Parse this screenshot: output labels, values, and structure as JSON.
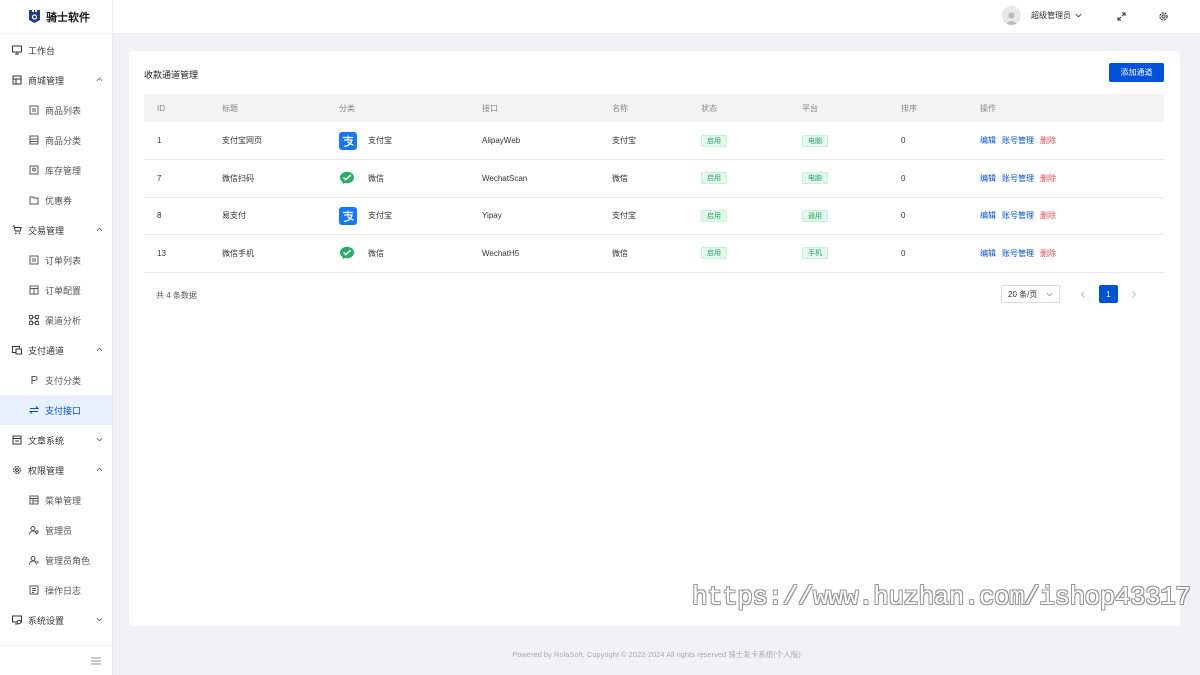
{
  "app": {
    "name": "骑士软件"
  },
  "sidebar": {
    "items": [
      {
        "label": "工作台",
        "icon": "monitor-icon",
        "type": "top"
      },
      {
        "label": "商城管理",
        "icon": "store-icon",
        "type": "group",
        "expanded": true
      },
      {
        "label": "商品列表",
        "icon": "list-icon",
        "type": "child"
      },
      {
        "label": "商品分类",
        "icon": "category-icon",
        "type": "child"
      },
      {
        "label": "库存管理",
        "icon": "inventory-icon",
        "type": "child"
      },
      {
        "label": "优惠券",
        "icon": "folder-icon",
        "type": "child"
      },
      {
        "label": "交易管理",
        "icon": "cart-icon",
        "type": "group",
        "expanded": true
      },
      {
        "label": "订单列表",
        "icon": "list-icon",
        "type": "child"
      },
      {
        "label": "订单配置",
        "icon": "config-icon",
        "type": "child"
      },
      {
        "label": "渠道分析",
        "icon": "nodes-icon",
        "type": "child"
      },
      {
        "label": "支付通道",
        "icon": "payment-icon",
        "type": "group",
        "expanded": true
      },
      {
        "label": "支付分类",
        "icon": "p-icon",
        "type": "child"
      },
      {
        "label": "支付接口",
        "icon": "swap-icon",
        "type": "child",
        "active": true
      },
      {
        "label": "文章系统",
        "icon": "article-icon",
        "type": "group",
        "expanded": false
      },
      {
        "label": "权限管理",
        "icon": "gear-icon",
        "type": "group",
        "expanded": true
      },
      {
        "label": "菜单管理",
        "icon": "menu-grid-icon",
        "type": "child"
      },
      {
        "label": "管理员",
        "icon": "user-icon",
        "type": "child"
      },
      {
        "label": "管理员角色",
        "icon": "user-role-icon",
        "type": "child"
      },
      {
        "label": "操作日志",
        "icon": "log-icon",
        "type": "child"
      },
      {
        "label": "系统设置",
        "icon": "settings-icon",
        "type": "group",
        "expanded": false
      }
    ]
  },
  "header": {
    "user_name": "超级管理员"
  },
  "main": {
    "title": "收款通道管理",
    "add_button": "添加通道",
    "columns": [
      "ID",
      "标题",
      "分类",
      "接口",
      "名称",
      "状态",
      "平台",
      "排序",
      "操作"
    ],
    "rows": [
      {
        "id": "1",
        "title": "支付宝网页",
        "category": "支付宝",
        "category_icon": "alipay-icon",
        "api": "AlipayWeb",
        "name": "支付宝",
        "status": "启用",
        "platform": "电脑",
        "sort": "0"
      },
      {
        "id": "7",
        "title": "微信扫码",
        "category": "微信",
        "category_icon": "wechat-icon",
        "api": "WechatScan",
        "name": "微信",
        "status": "启用",
        "platform": "电脑",
        "sort": "0"
      },
      {
        "id": "8",
        "title": "易支付",
        "category": "支付宝",
        "category_icon": "alipay-icon",
        "api": "Yipay",
        "name": "支付宝",
        "status": "启用",
        "platform": "通用",
        "sort": "0"
      },
      {
        "id": "13",
        "title": "微信手机",
        "category": "微信",
        "category_icon": "wechat-icon",
        "api": "WechatH5",
        "name": "微信",
        "status": "启用",
        "platform": "手机",
        "sort": "0"
      }
    ],
    "actions": {
      "edit": "编辑",
      "account": "账号管理",
      "delete": "删除"
    },
    "total_text": "共 4 条数据",
    "page_size": "20 条/页",
    "current_page": "1"
  },
  "watermark": "https://www.huzhan.com/ishop43317",
  "footer": "Powered by RolaSoft, Copyright © 2022-2024 All rights reserved  骑士发卡系统(个人版)",
  "colors": {
    "primary": "#0052d9",
    "danger": "#e34d59",
    "success": "#2ba471",
    "alipay": "#1677ff",
    "wechat": "#2aae67"
  }
}
